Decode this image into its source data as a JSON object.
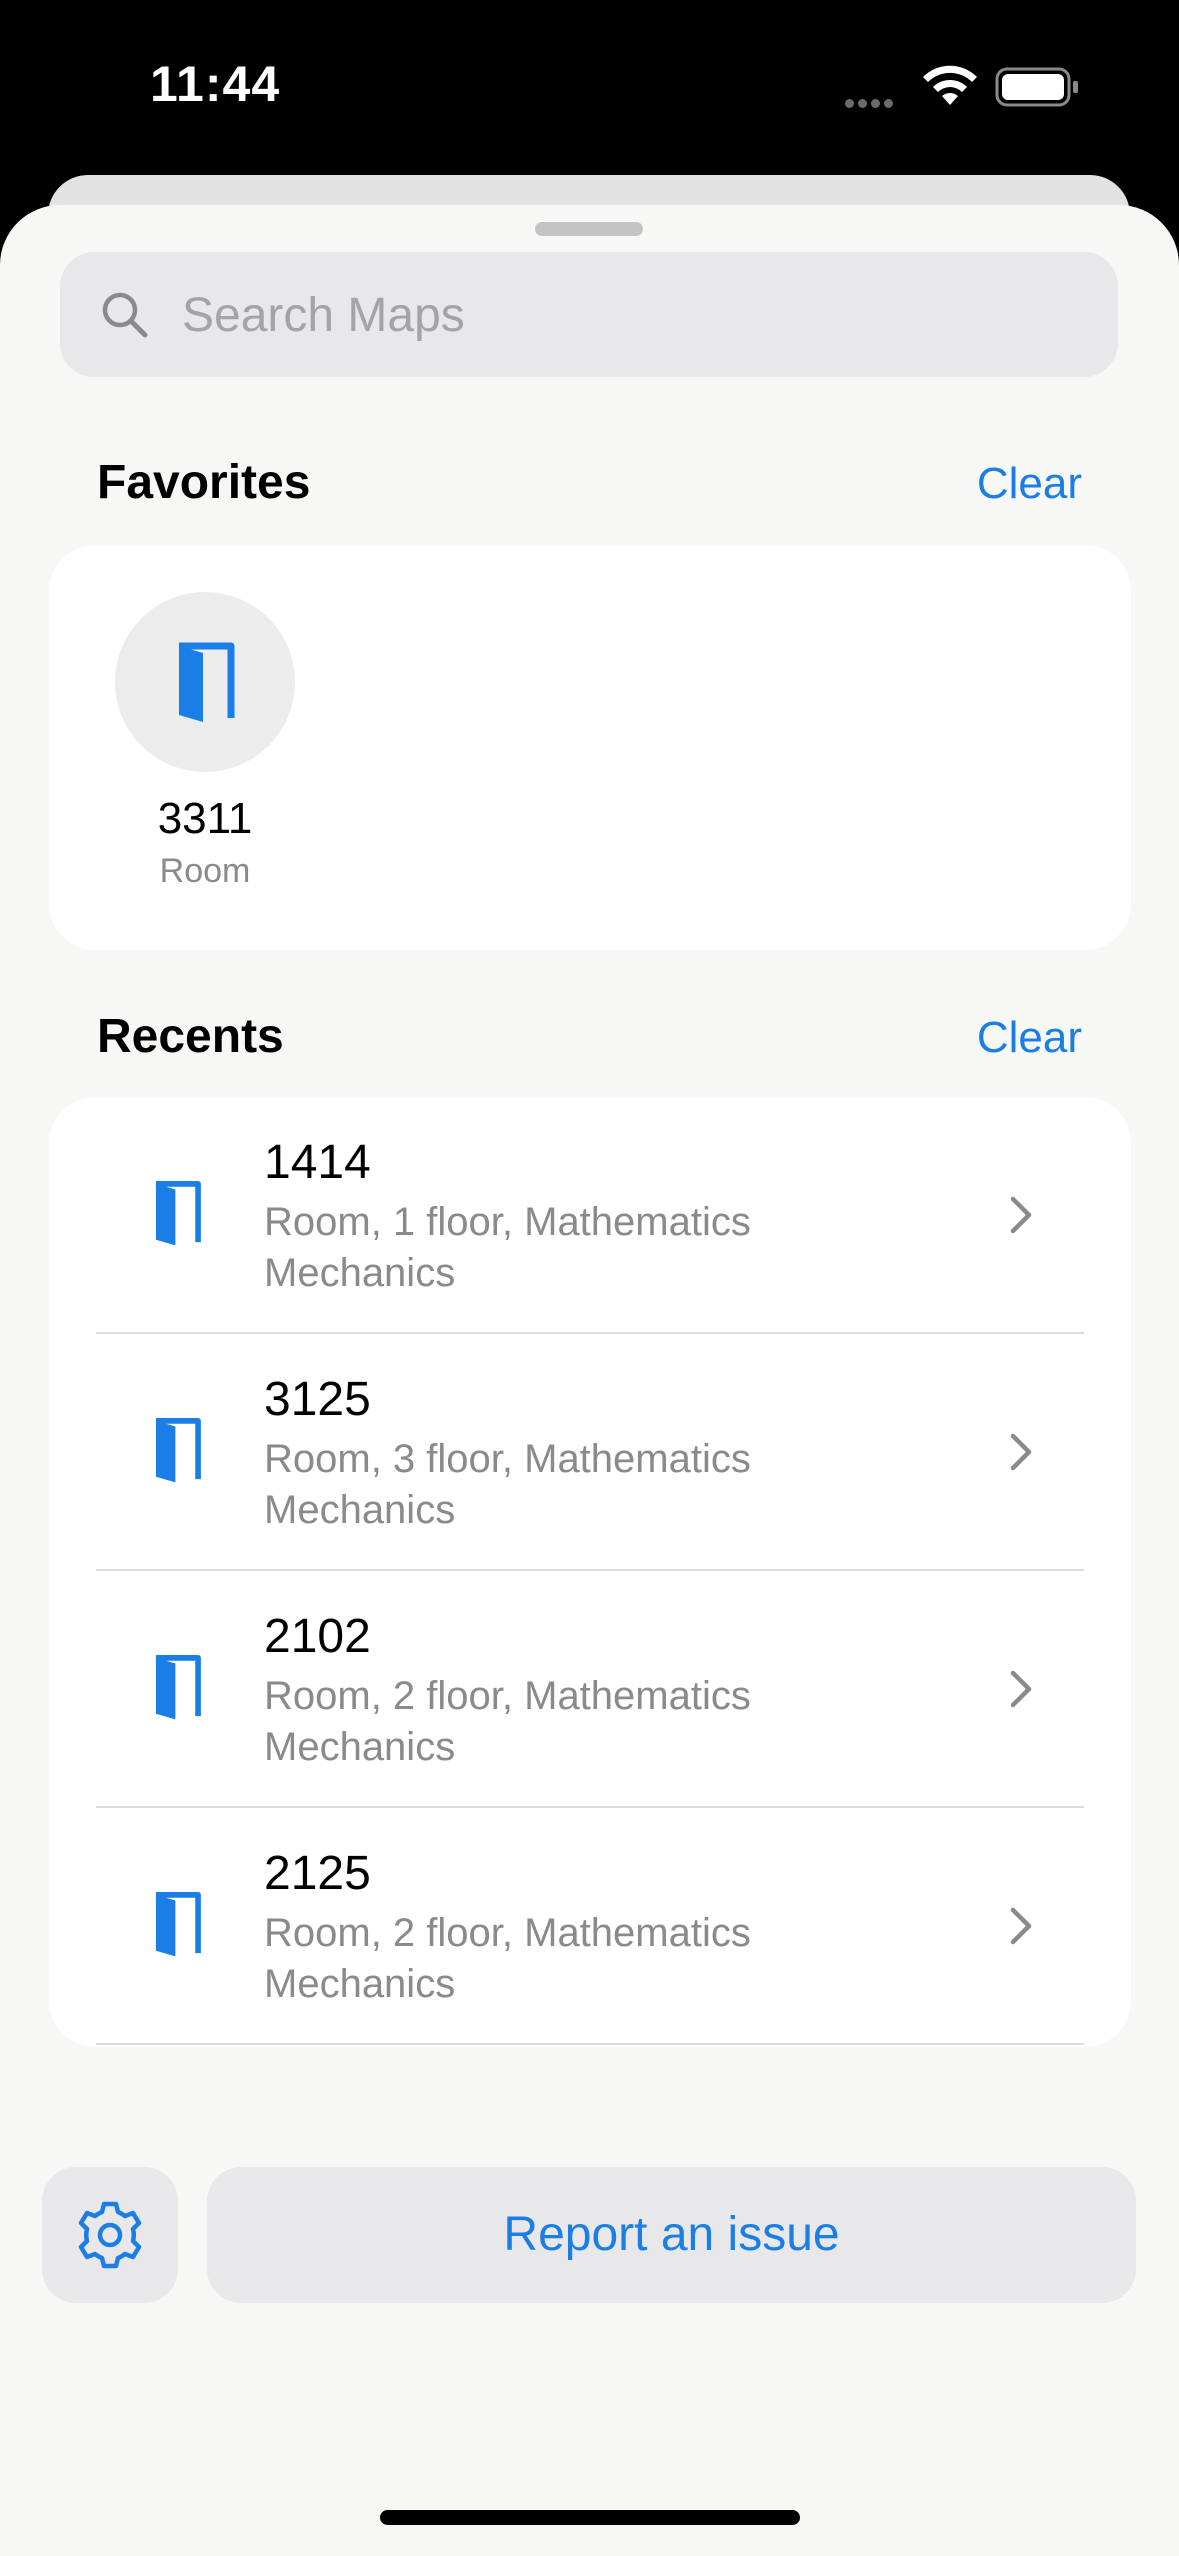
{
  "status_bar": {
    "time": "11:44"
  },
  "search": {
    "placeholder": "Search Maps"
  },
  "favorites": {
    "title": "Favorites",
    "clear_label": "Clear",
    "items": [
      {
        "title": "3311",
        "subtitle": "Room",
        "icon": "door-icon"
      }
    ]
  },
  "recents": {
    "title": "Recents",
    "clear_label": "Clear",
    "items": [
      {
        "title": "1414",
        "subtitle": "Room, 1 floor, Mathematics Mechanics",
        "icon": "door-icon"
      },
      {
        "title": "3125",
        "subtitle": "Room, 3 floor, Mathematics Mechanics",
        "icon": "door-icon"
      },
      {
        "title": "2102",
        "subtitle": "Room, 2 floor, Mathematics Mechanics",
        "icon": "door-icon"
      },
      {
        "title": "2125",
        "subtitle": "Room, 2 floor, Mathematics Mechanics",
        "icon": "door-icon"
      }
    ]
  },
  "footer": {
    "settings_icon": "gear-icon",
    "report_label": "Report an issue"
  },
  "colors": {
    "accent": "#1a7ee6",
    "sheet_background": "#f7f7f5",
    "secondary_text": "#8a8a8e"
  }
}
